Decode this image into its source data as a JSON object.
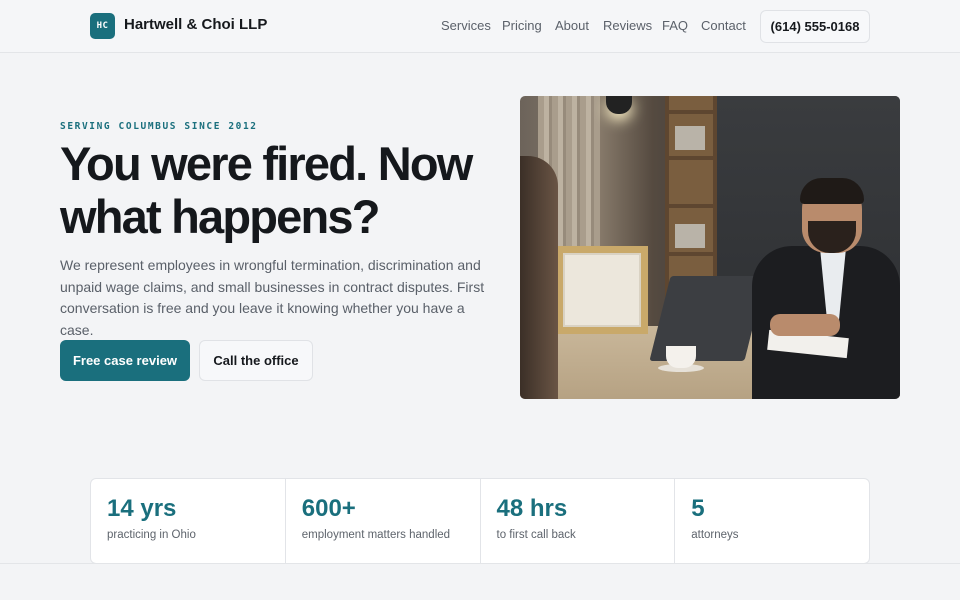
{
  "brand": {
    "badge": "HC",
    "name": "Hartwell & Choi LLP"
  },
  "nav": {
    "items": [
      "Services",
      "Pricing",
      "About",
      "Reviews",
      "FAQ",
      "Contact"
    ],
    "phone": "(614) 555-0168"
  },
  "hero": {
    "eyebrow": "SERVING COLUMBUS SINCE 2012",
    "headline": "You were fired. Now what happens?",
    "lede": "We represent employees in wrongful termination, discrimination and unpaid wage claims, and small businesses in contract disputes. First conversation is free and you leave it knowing whether you have a case.",
    "primary_cta": "Free case review",
    "secondary_cta": "Call the office"
  },
  "stats": [
    {
      "value": "14 yrs",
      "label": "practicing in Ohio"
    },
    {
      "value": "600+",
      "label": "employment matters handled"
    },
    {
      "value": "48 hrs",
      "label": "to first call back"
    },
    {
      "value": "5",
      "label": "attorneys"
    }
  ],
  "colors": {
    "accent": "#1a6f7d",
    "background": "#f3f4f6",
    "text": "#15181c"
  }
}
